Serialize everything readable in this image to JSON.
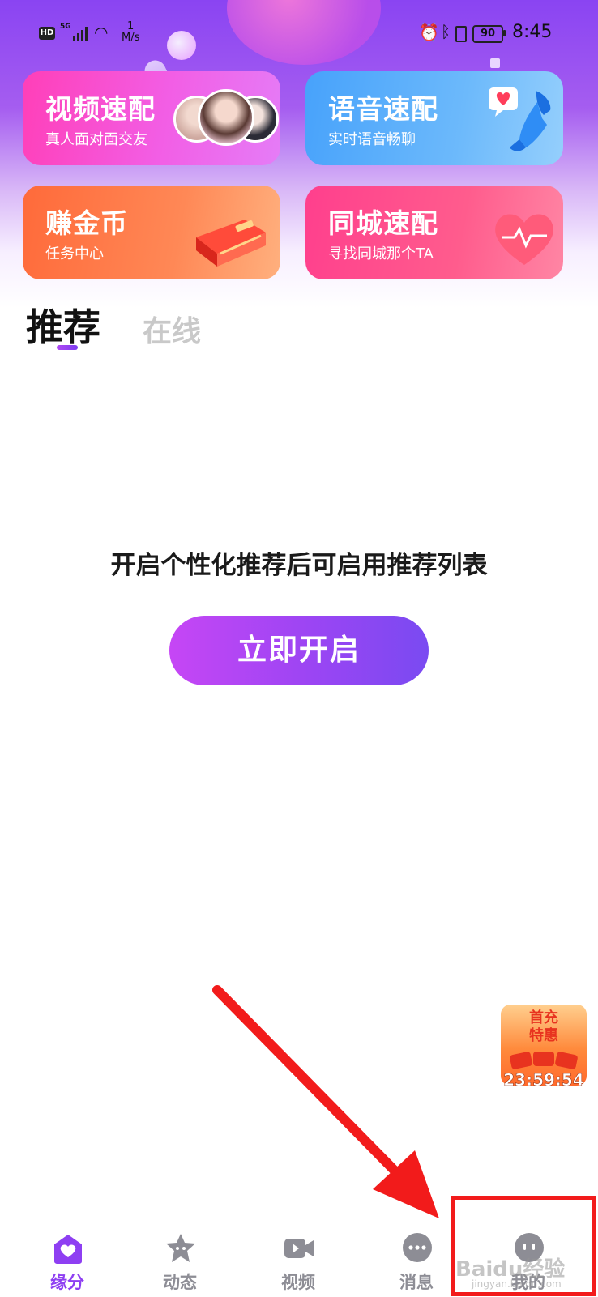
{
  "status_bar": {
    "hd": "HD",
    "network": "5G",
    "speed_value": "1",
    "speed_unit": "M/s",
    "battery": "90",
    "time": "8:45"
  },
  "cards": {
    "video": {
      "title": "视频速配",
      "subtitle": "真人面对面交友"
    },
    "voice": {
      "title": "语音速配",
      "subtitle": "实时语音畅聊"
    },
    "coins": {
      "title": "赚金币",
      "subtitle": "任务中心"
    },
    "city": {
      "title": "同城速配",
      "subtitle": "寻找同城那个TA"
    }
  },
  "tabs": [
    {
      "label": "推荐",
      "active": true
    },
    {
      "label": "在线",
      "active": false
    }
  ],
  "empty_state": {
    "message": "开启个性化推荐后可启用推荐列表",
    "button_label": "立即开启"
  },
  "promo": {
    "line1": "首充",
    "line2": "特惠",
    "countdown": "23:59:54"
  },
  "bottom_nav": [
    {
      "label": "缘分",
      "icon": "heart-house-icon",
      "active": true
    },
    {
      "label": "动态",
      "icon": "star-face-icon",
      "active": false
    },
    {
      "label": "视频",
      "icon": "video-camera-icon",
      "active": false
    },
    {
      "label": "消息",
      "icon": "chat-bubble-icon",
      "active": false
    },
    {
      "label": "我的",
      "icon": "profile-face-icon",
      "active": false
    }
  ],
  "watermark": {
    "text": "Baidu经验",
    "subtext": "jingyan.baidu.com"
  },
  "colors": {
    "accent": "#8e3ff2",
    "highlight_box": "#f21b1b",
    "arrow": "#f21b1b"
  }
}
